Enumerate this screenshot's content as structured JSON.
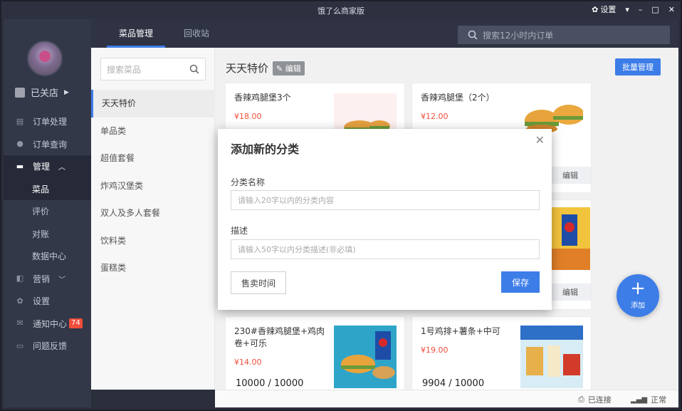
{
  "window": {
    "title": "饿了么商家版",
    "settings_label": "设置",
    "controls": [
      "▾",
      "–",
      "□",
      "✕"
    ]
  },
  "sidebar": {
    "shop_status": "已关店",
    "items": [
      {
        "label": "订单处理",
        "icon": "list-icon"
      },
      {
        "label": "订单查询",
        "icon": "clock-icon"
      },
      {
        "label": "管理",
        "icon": "monitor-icon"
      },
      {
        "label": "菜品"
      },
      {
        "label": "评价"
      },
      {
        "label": "对账"
      },
      {
        "label": "数据中心"
      },
      {
        "label": "营销",
        "icon": "megaphone-icon"
      },
      {
        "label": "设置",
        "icon": "gear-icon"
      },
      {
        "label": "通知中心",
        "icon": "mail-icon",
        "badge": "74"
      },
      {
        "label": "问题反馈",
        "icon": "chat-icon"
      }
    ]
  },
  "tabs": [
    {
      "label": "菜品管理"
    },
    {
      "label": "回收站"
    }
  ],
  "order_search": {
    "placeholder": "搜索12小时内订单"
  },
  "category_panel": {
    "search_placeholder": "搜索菜品",
    "categories": [
      "天天特价",
      "单品类",
      "超值套餐",
      "炸鸡汉堡类",
      "双人及多人套餐",
      "饮料类",
      "蛋糕类"
    ]
  },
  "content": {
    "title": "天天特价",
    "edit_tag": "编辑",
    "batch_button": "批量管理",
    "cards": [
      {
        "name": "香辣鸡腿堡3个",
        "price": "¥18.00",
        "stock": "",
        "edit": ""
      },
      {
        "name": "香辣鸡腿堡（2个）",
        "price": "¥12.00",
        "stock": "",
        "edit": "编辑"
      },
      {
        "name": "",
        "price": "",
        "stock": "",
        "edit": "编辑"
      },
      {
        "name": "230#香辣鸡腿堡+鸡肉卷+可乐",
        "price": "¥14.00",
        "stock": "10000 / 10000",
        "edit": ""
      },
      {
        "name": "1号鸡排+薯条+中可",
        "price": "¥19.00",
        "stock": "9904 / 10000",
        "edit": ""
      }
    ]
  },
  "modal": {
    "title": "添加新的分类",
    "name_label": "分类名称",
    "name_placeholder": "请输入20字以内的分类内容",
    "desc_label": "描述",
    "desc_placeholder": "请输入50字以内分类描述(非必填)",
    "time_button": "售卖时间",
    "save_button": "保存"
  },
  "fab": {
    "label": "添加"
  },
  "footer": {
    "connected": "已连接",
    "signal": "正常"
  },
  "colors": {
    "accent": "#3d7de8",
    "price": "#f04d3a",
    "sidebar": "#333849",
    "badge": "#f04d3a"
  }
}
